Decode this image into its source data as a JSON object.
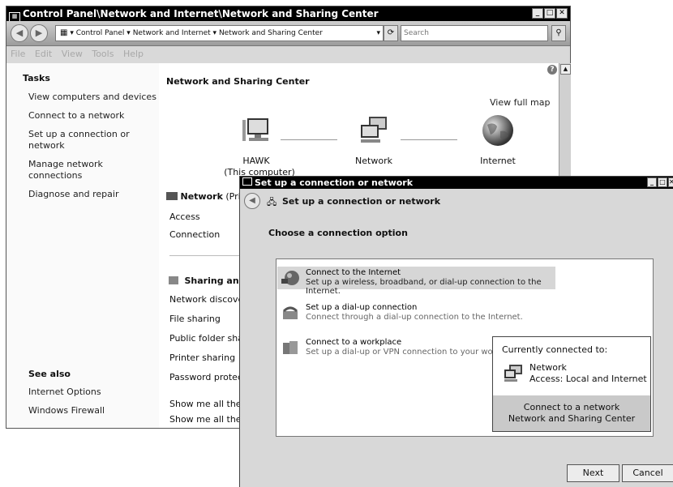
{
  "main_window": {
    "title": "Control Panel\\Network and Internet\\Network and Sharing Center",
    "controls": {
      "minimize": "_",
      "maximize": "□",
      "close": "✕"
    },
    "breadcrumb": [
      "Control Panel",
      "Network and Internet",
      "Network and Sharing Center"
    ],
    "search_placeholder": "Search",
    "menu": [
      "File",
      "Edit",
      "View",
      "Tools",
      "Help"
    ],
    "tasks": {
      "heading": "Tasks",
      "items": [
        "View computers and devices",
        "Connect to a network",
        "Set up a connection or network",
        "Manage network connections",
        "Diagnose and repair"
      ]
    },
    "see_also": {
      "heading": "See also",
      "items": [
        "Internet Options",
        "Windows Firewall"
      ]
    },
    "page_title": "Network and Sharing Center",
    "view_full_map": "View full map",
    "map": {
      "computer_name": "HAWK",
      "computer_sub": "(This computer)",
      "network": "Network",
      "internet": "Internet"
    },
    "network_section": {
      "title": "Network",
      "title_cut": "(Pri",
      "rows": [
        "Access",
        "Connection"
      ]
    },
    "sharing_section": {
      "title": "Sharing anc",
      "rows": [
        "Network discover",
        "File sharing",
        "Public folder sha",
        "Printer sharing",
        "Password protec"
      ]
    },
    "show_links": [
      "Show me all the",
      "Show me all the"
    ]
  },
  "dialog": {
    "title": "Set up a connection or network",
    "header": "Set up a connection or network",
    "prompt": "Choose a connection option",
    "options": [
      {
        "title": "Connect to the Internet",
        "subtitle": "Set up a wireless, broadband, or dial-up connection to the Internet."
      },
      {
        "title": "Set up a dial-up connection",
        "subtitle": "Connect through a dial-up connection to the Internet."
      },
      {
        "title": "Connect to a workplace",
        "subtitle": "Set up a dial-up or VPN connection to your workp"
      }
    ],
    "buttons": {
      "next": "Next",
      "cancel": "Cancel"
    }
  },
  "popup": {
    "heading": "Currently connected to:",
    "network_name": "Network",
    "access": "Access:  Local and Internet",
    "footer_links": [
      "Connect to a network",
      "Network and Sharing Center"
    ]
  }
}
